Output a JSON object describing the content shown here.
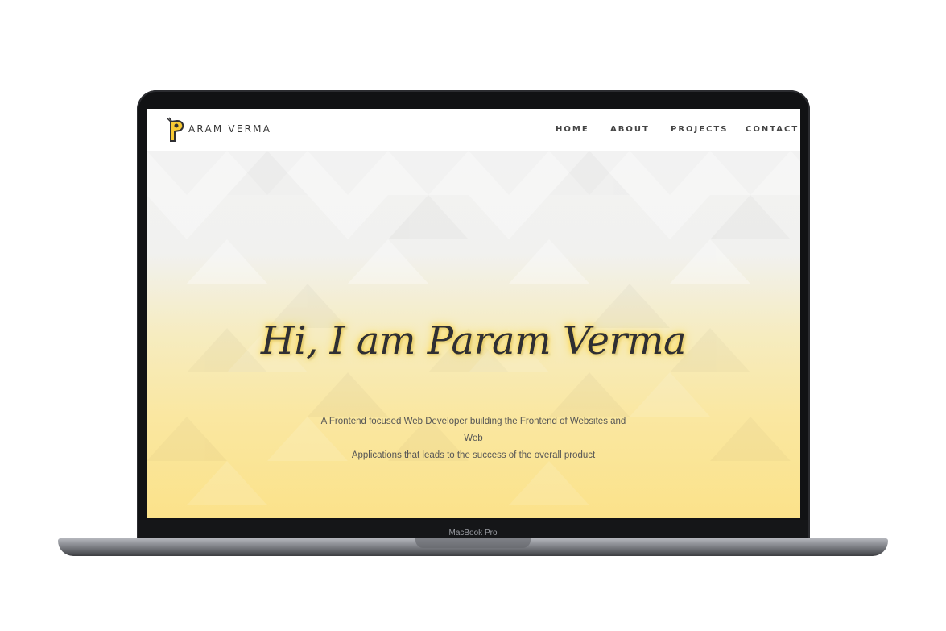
{
  "device": {
    "label": "MacBook Pro"
  },
  "site": {
    "logo_icon": "p-letter-logo-icon",
    "brand": "ARAM VERMA",
    "nav": [
      {
        "label": "HOME"
      },
      {
        "label": "ABOUT"
      },
      {
        "label": "PROJECTS"
      },
      {
        "label": "CONTACT"
      }
    ],
    "hero": {
      "title": "Hi, I am Param Verma",
      "subtitle_line1": "A Frontend focused Web Developer building the Frontend of Websites and Web",
      "subtitle_line2": "Applications that leads to the success of the overall product"
    },
    "colors": {
      "accent_yellow": "#fbe28a",
      "logo_yellow": "#f7c934",
      "text_dark": "#2f2f33"
    }
  }
}
